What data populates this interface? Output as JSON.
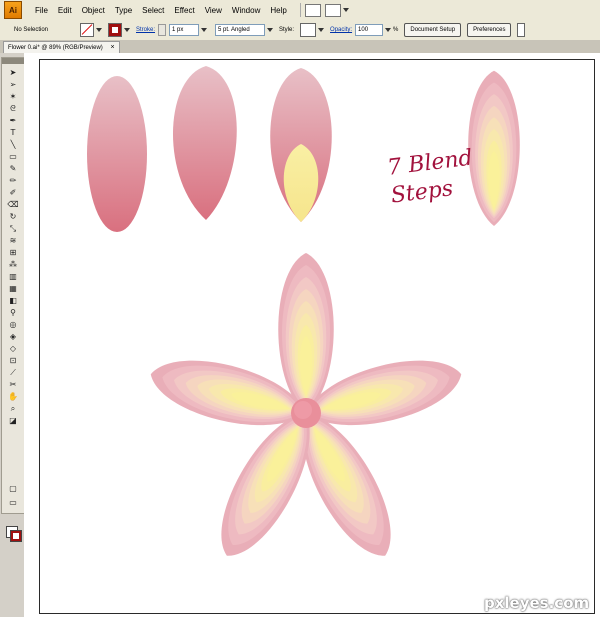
{
  "app": {
    "logo": "Ai"
  },
  "menu": [
    "File",
    "Edit",
    "Object",
    "Type",
    "Select",
    "Effect",
    "View",
    "Window",
    "Help"
  ],
  "control": {
    "selection": "No Selection",
    "stroke_label": "Stroke:",
    "stroke_value": "1 px",
    "brush": "5 pt. Angled",
    "style_label": "Style:",
    "opacity_label": "Opacity:",
    "opacity_value": "100",
    "percent": "%",
    "document_setup": "Document Setup",
    "preferences": "Preferences"
  },
  "document_tab": {
    "title": "Flower 0.ai* @ 89% (RGB/Preview)",
    "close": "×"
  },
  "artwork": {
    "annotation_line1": "7 Blend",
    "annotation_line2": "Steps"
  },
  "colors": {
    "petal_pink": "#dd7f8b",
    "petal_light": "#e8bcc4",
    "petal_yellow": "#fbf2a0",
    "center": "#e98f9b",
    "annotation": "#a2123d"
  },
  "watermark": "pxleyes.com"
}
